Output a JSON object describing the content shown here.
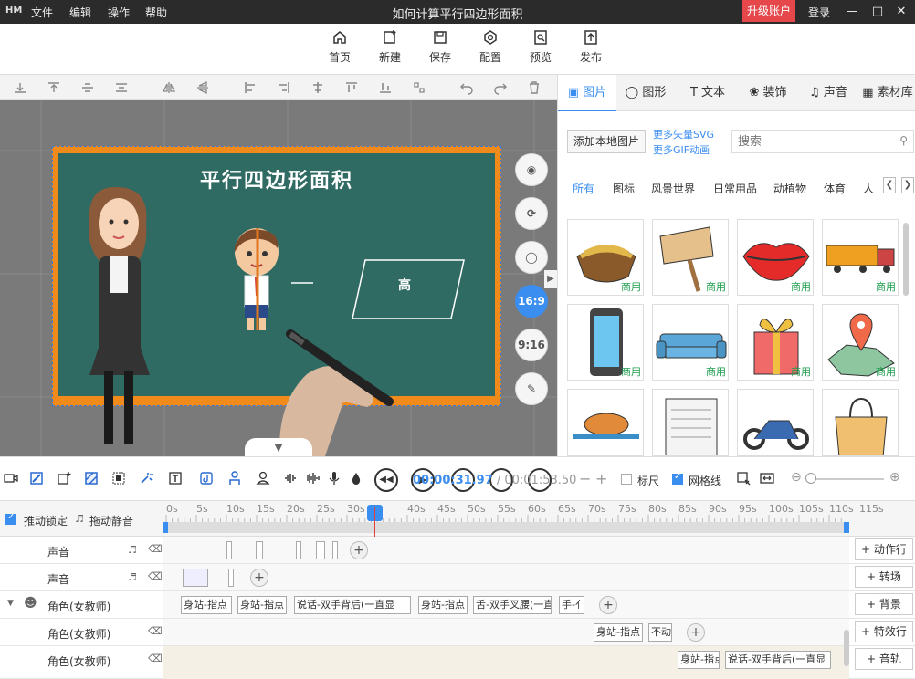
{
  "window": {
    "title": "如何计算平行四边形面积",
    "logo": "HM",
    "menu": [
      "文件",
      "编辑",
      "操作",
      "帮助"
    ],
    "upgrade_label": "升级账户",
    "login_label": "登录"
  },
  "main_toolbar": {
    "items": [
      {
        "label": "首页",
        "icon": "home-icon"
      },
      {
        "label": "新建",
        "icon": "new-icon"
      },
      {
        "label": "保存",
        "icon": "save-icon"
      },
      {
        "label": "配置",
        "icon": "config-icon"
      },
      {
        "label": "预览",
        "icon": "preview-icon"
      },
      {
        "label": "发布",
        "icon": "publish-icon"
      }
    ]
  },
  "canvas": {
    "board_title": "平行四边形面积",
    "parallelogram_label": "高",
    "side_buttons": [
      "16:9",
      "9:16"
    ]
  },
  "right_panel": {
    "tabs": [
      "图片",
      "图形",
      "文本",
      "装饰",
      "声音",
      "素材库"
    ],
    "add_local": "添加本地图片",
    "more_svg": "更多矢量SVG",
    "more_gif": "更多GIF动画",
    "search_placeholder": "搜索",
    "categories": [
      "所有",
      "图标",
      "风景世界",
      "日常用品",
      "动植物",
      "体育",
      "人"
    ],
    "commercial_tag": "商用"
  },
  "timeline_toolbar": {
    "current_time": "00:00:31.97",
    "total_time": "00:01:53.50",
    "ruler_label": "标尺",
    "grid_label": "网格线"
  },
  "timeline": {
    "lock_label": "推动锁定",
    "mute_label": "拖动静音",
    "ticks": [
      "0s",
      "5s",
      "10s",
      "15s",
      "20s",
      "25s",
      "30s",
      "40s",
      "45s",
      "50s",
      "55s",
      "60s",
      "65s",
      "70s",
      "75s",
      "80s",
      "85s",
      "90s",
      "95s",
      "100s",
      "105s",
      "110s",
      "115s"
    ],
    "tracks": [
      {
        "name": "声音",
        "clips": []
      },
      {
        "name": "声音",
        "clips": []
      },
      {
        "name": "角色(女教师)",
        "clips": [
          "身站-指点",
          "身站-指点",
          "说话-双手背后(一直显",
          "身站-指点",
          "舌-双手叉腰(一直",
          "手-亻"
        ]
      },
      {
        "name": "角色(女教师)",
        "clips": [
          "身站-指点",
          "不动"
        ]
      },
      {
        "name": "角色(女教师)",
        "clips": [
          "身站-指点",
          "说话-双手背后(一直显"
        ]
      }
    ],
    "right_buttons": [
      "动作行",
      "转场",
      "背景",
      "特效行",
      "音轨"
    ]
  }
}
